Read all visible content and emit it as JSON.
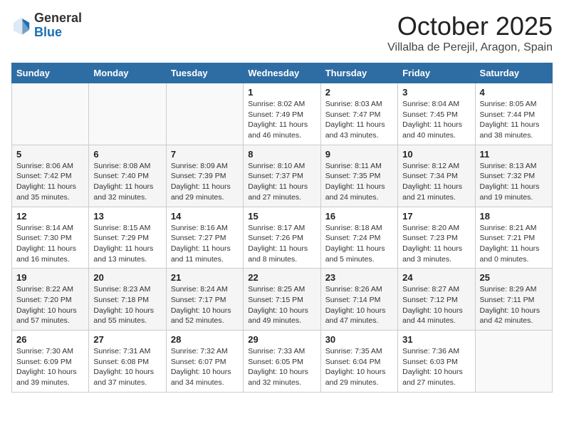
{
  "logo": {
    "general": "General",
    "blue": "Blue"
  },
  "header": {
    "month": "October 2025",
    "location": "Villalba de Perejil, Aragon, Spain"
  },
  "weekdays": [
    "Sunday",
    "Monday",
    "Tuesday",
    "Wednesday",
    "Thursday",
    "Friday",
    "Saturday"
  ],
  "weeks": [
    [
      {
        "day": "",
        "sunrise": "",
        "sunset": "",
        "daylight": ""
      },
      {
        "day": "",
        "sunrise": "",
        "sunset": "",
        "daylight": ""
      },
      {
        "day": "",
        "sunrise": "",
        "sunset": "",
        "daylight": ""
      },
      {
        "day": "1",
        "sunrise": "Sunrise: 8:02 AM",
        "sunset": "Sunset: 7:49 PM",
        "daylight": "Daylight: 11 hours and 46 minutes."
      },
      {
        "day": "2",
        "sunrise": "Sunrise: 8:03 AM",
        "sunset": "Sunset: 7:47 PM",
        "daylight": "Daylight: 11 hours and 43 minutes."
      },
      {
        "day": "3",
        "sunrise": "Sunrise: 8:04 AM",
        "sunset": "Sunset: 7:45 PM",
        "daylight": "Daylight: 11 hours and 40 minutes."
      },
      {
        "day": "4",
        "sunrise": "Sunrise: 8:05 AM",
        "sunset": "Sunset: 7:44 PM",
        "daylight": "Daylight: 11 hours and 38 minutes."
      }
    ],
    [
      {
        "day": "5",
        "sunrise": "Sunrise: 8:06 AM",
        "sunset": "Sunset: 7:42 PM",
        "daylight": "Daylight: 11 hours and 35 minutes."
      },
      {
        "day": "6",
        "sunrise": "Sunrise: 8:08 AM",
        "sunset": "Sunset: 7:40 PM",
        "daylight": "Daylight: 11 hours and 32 minutes."
      },
      {
        "day": "7",
        "sunrise": "Sunrise: 8:09 AM",
        "sunset": "Sunset: 7:39 PM",
        "daylight": "Daylight: 11 hours and 29 minutes."
      },
      {
        "day": "8",
        "sunrise": "Sunrise: 8:10 AM",
        "sunset": "Sunset: 7:37 PM",
        "daylight": "Daylight: 11 hours and 27 minutes."
      },
      {
        "day": "9",
        "sunrise": "Sunrise: 8:11 AM",
        "sunset": "Sunset: 7:35 PM",
        "daylight": "Daylight: 11 hours and 24 minutes."
      },
      {
        "day": "10",
        "sunrise": "Sunrise: 8:12 AM",
        "sunset": "Sunset: 7:34 PM",
        "daylight": "Daylight: 11 hours and 21 minutes."
      },
      {
        "day": "11",
        "sunrise": "Sunrise: 8:13 AM",
        "sunset": "Sunset: 7:32 PM",
        "daylight": "Daylight: 11 hours and 19 minutes."
      }
    ],
    [
      {
        "day": "12",
        "sunrise": "Sunrise: 8:14 AM",
        "sunset": "Sunset: 7:30 PM",
        "daylight": "Daylight: 11 hours and 16 minutes."
      },
      {
        "day": "13",
        "sunrise": "Sunrise: 8:15 AM",
        "sunset": "Sunset: 7:29 PM",
        "daylight": "Daylight: 11 hours and 13 minutes."
      },
      {
        "day": "14",
        "sunrise": "Sunrise: 8:16 AM",
        "sunset": "Sunset: 7:27 PM",
        "daylight": "Daylight: 11 hours and 11 minutes."
      },
      {
        "day": "15",
        "sunrise": "Sunrise: 8:17 AM",
        "sunset": "Sunset: 7:26 PM",
        "daylight": "Daylight: 11 hours and 8 minutes."
      },
      {
        "day": "16",
        "sunrise": "Sunrise: 8:18 AM",
        "sunset": "Sunset: 7:24 PM",
        "daylight": "Daylight: 11 hours and 5 minutes."
      },
      {
        "day": "17",
        "sunrise": "Sunrise: 8:20 AM",
        "sunset": "Sunset: 7:23 PM",
        "daylight": "Daylight: 11 hours and 3 minutes."
      },
      {
        "day": "18",
        "sunrise": "Sunrise: 8:21 AM",
        "sunset": "Sunset: 7:21 PM",
        "daylight": "Daylight: 11 hours and 0 minutes."
      }
    ],
    [
      {
        "day": "19",
        "sunrise": "Sunrise: 8:22 AM",
        "sunset": "Sunset: 7:20 PM",
        "daylight": "Daylight: 10 hours and 57 minutes."
      },
      {
        "day": "20",
        "sunrise": "Sunrise: 8:23 AM",
        "sunset": "Sunset: 7:18 PM",
        "daylight": "Daylight: 10 hours and 55 minutes."
      },
      {
        "day": "21",
        "sunrise": "Sunrise: 8:24 AM",
        "sunset": "Sunset: 7:17 PM",
        "daylight": "Daylight: 10 hours and 52 minutes."
      },
      {
        "day": "22",
        "sunrise": "Sunrise: 8:25 AM",
        "sunset": "Sunset: 7:15 PM",
        "daylight": "Daylight: 10 hours and 49 minutes."
      },
      {
        "day": "23",
        "sunrise": "Sunrise: 8:26 AM",
        "sunset": "Sunset: 7:14 PM",
        "daylight": "Daylight: 10 hours and 47 minutes."
      },
      {
        "day": "24",
        "sunrise": "Sunrise: 8:27 AM",
        "sunset": "Sunset: 7:12 PM",
        "daylight": "Daylight: 10 hours and 44 minutes."
      },
      {
        "day": "25",
        "sunrise": "Sunrise: 8:29 AM",
        "sunset": "Sunset: 7:11 PM",
        "daylight": "Daylight: 10 hours and 42 minutes."
      }
    ],
    [
      {
        "day": "26",
        "sunrise": "Sunrise: 7:30 AM",
        "sunset": "Sunset: 6:09 PM",
        "daylight": "Daylight: 10 hours and 39 minutes."
      },
      {
        "day": "27",
        "sunrise": "Sunrise: 7:31 AM",
        "sunset": "Sunset: 6:08 PM",
        "daylight": "Daylight: 10 hours and 37 minutes."
      },
      {
        "day": "28",
        "sunrise": "Sunrise: 7:32 AM",
        "sunset": "Sunset: 6:07 PM",
        "daylight": "Daylight: 10 hours and 34 minutes."
      },
      {
        "day": "29",
        "sunrise": "Sunrise: 7:33 AM",
        "sunset": "Sunset: 6:05 PM",
        "daylight": "Daylight: 10 hours and 32 minutes."
      },
      {
        "day": "30",
        "sunrise": "Sunrise: 7:35 AM",
        "sunset": "Sunset: 6:04 PM",
        "daylight": "Daylight: 10 hours and 29 minutes."
      },
      {
        "day": "31",
        "sunrise": "Sunrise: 7:36 AM",
        "sunset": "Sunset: 6:03 PM",
        "daylight": "Daylight: 10 hours and 27 minutes."
      },
      {
        "day": "",
        "sunrise": "",
        "sunset": "",
        "daylight": ""
      }
    ]
  ]
}
